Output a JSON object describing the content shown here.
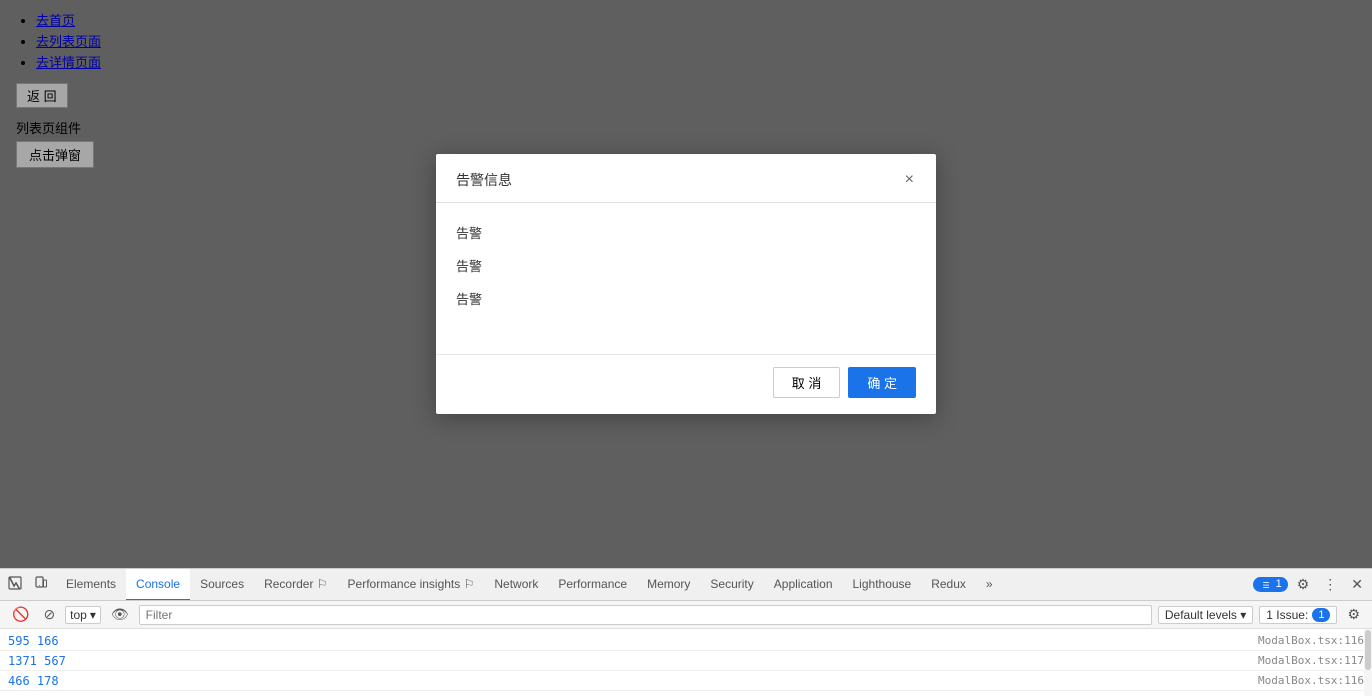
{
  "page": {
    "nav": {
      "home_link": "去首页",
      "list_link": "去列表页面",
      "detail_link": "去详情页面",
      "back_btn": "返 回"
    },
    "section_label": "列表页组件",
    "popup_btn": "点击弹窗"
  },
  "modal": {
    "title": "告警信息",
    "close_btn": "×",
    "alert1": "告警",
    "alert2": "告警",
    "alert3": "告警",
    "cancel_btn": "取 消",
    "confirm_btn": "确 定"
  },
  "devtools": {
    "tabs": [
      {
        "id": "elements",
        "label": "Elements",
        "active": false
      },
      {
        "id": "console",
        "label": "Console",
        "active": true
      },
      {
        "id": "sources",
        "label": "Sources",
        "active": false
      },
      {
        "id": "recorder",
        "label": "Recorder ⚐",
        "active": false
      },
      {
        "id": "performance-insights",
        "label": "Performance insights ⚐",
        "active": false
      },
      {
        "id": "network",
        "label": "Network",
        "active": false
      },
      {
        "id": "performance",
        "label": "Performance",
        "active": false
      },
      {
        "id": "memory",
        "label": "Memory",
        "active": false
      },
      {
        "id": "security",
        "label": "Security",
        "active": false
      },
      {
        "id": "application",
        "label": "Application",
        "active": false
      },
      {
        "id": "lighthouse",
        "label": "Lighthouse",
        "active": false
      },
      {
        "id": "redux",
        "label": "Redux",
        "active": false
      }
    ],
    "badge_count": "1",
    "more_tabs": "»",
    "console_toolbar": {
      "context_label": "top",
      "filter_placeholder": "Filter",
      "default_levels": "Default levels ▾",
      "issue_text": "1 Issue:",
      "issue_count": "1"
    },
    "console_rows": [
      {
        "left": "595 166",
        "right": "ModalBox.tsx:116"
      },
      {
        "left": "1371 567",
        "right": "ModalBox.tsx:117"
      },
      {
        "left": "466 178",
        "right": "ModalBox.tsx:116"
      }
    ]
  }
}
